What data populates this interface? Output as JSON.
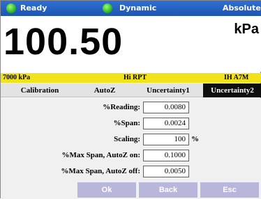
{
  "status": {
    "ready": "Ready",
    "mode": "Dynamic",
    "reference": "Absolute"
  },
  "reading": {
    "value": "100.50",
    "unit": "kPa"
  },
  "info": {
    "range": "7000 kPa",
    "sensor": "Hi RPT",
    "id": "IH A7M"
  },
  "tabs": [
    "Calibration",
    "AutoZ",
    "Uncertainty1",
    "Uncertainty2"
  ],
  "active_tab": "Uncertainty2",
  "form": {
    "reading": {
      "label": "%Reading:",
      "value": "0.0080"
    },
    "span": {
      "label": "%Span:",
      "value": "0.0024"
    },
    "scaling": {
      "label": "Scaling:",
      "value": "100",
      "suffix": "%"
    },
    "max_span_on": {
      "label": "%Max Span, AutoZ on:",
      "value": "0.1000"
    },
    "max_span_off": {
      "label": "%Max Span, AutoZ off:",
      "value": "0.0050"
    }
  },
  "buttons": {
    "ok": "Ok",
    "back": "Back",
    "esc": "Esc"
  },
  "colors": {
    "status_bar": "#1d55b3",
    "led": "#2fb82a",
    "info_bar": "#f2e21a",
    "active_tab": "#0e0e0e",
    "button": "#b9b6dc"
  }
}
